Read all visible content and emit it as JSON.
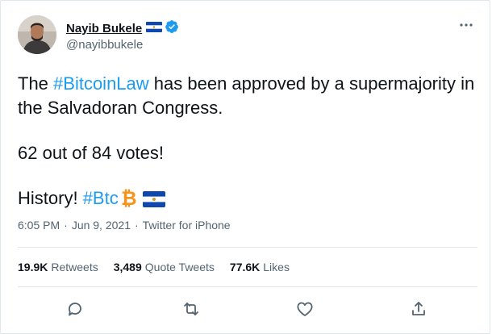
{
  "author": {
    "name": "Nayib Bukele",
    "handle": "@nayibbukele"
  },
  "tweet": {
    "line1_prefix": "The ",
    "line1_hashtag": "#BitcoinLaw",
    "line1_suffix": " has been approved by a supermajority in the Salvadoran Congress.",
    "line2": "62 out of 84 votes!",
    "line3_prefix": "History! ",
    "line3_hashtag": "#Btc"
  },
  "meta": {
    "time": "6:05 PM",
    "separator": "·",
    "date": "Jun 9, 2021",
    "source": "Twitter for iPhone"
  },
  "stats": {
    "retweets_count": "19.9K",
    "retweets_label": "Retweets",
    "quotes_count": "3,489",
    "quotes_label": "Quote Tweets",
    "likes_count": "77.6K",
    "likes_label": "Likes"
  },
  "colors": {
    "hashtag": "#1d9bf0",
    "verified": "#1d9bf0",
    "bitcoin": "#f7931a",
    "flag_blue": "#0f47af",
    "secondary_text": "#536471",
    "border": "#e1e8ed"
  },
  "icons": {
    "more": "more-horizontal-icon",
    "verified": "verified-badge-icon",
    "reply": "reply-icon",
    "retweet": "retweet-icon",
    "like": "heart-icon",
    "share": "share-icon",
    "bitcoin": "bitcoin-emoji-icon",
    "flag": "el-salvador-flag-icon"
  }
}
